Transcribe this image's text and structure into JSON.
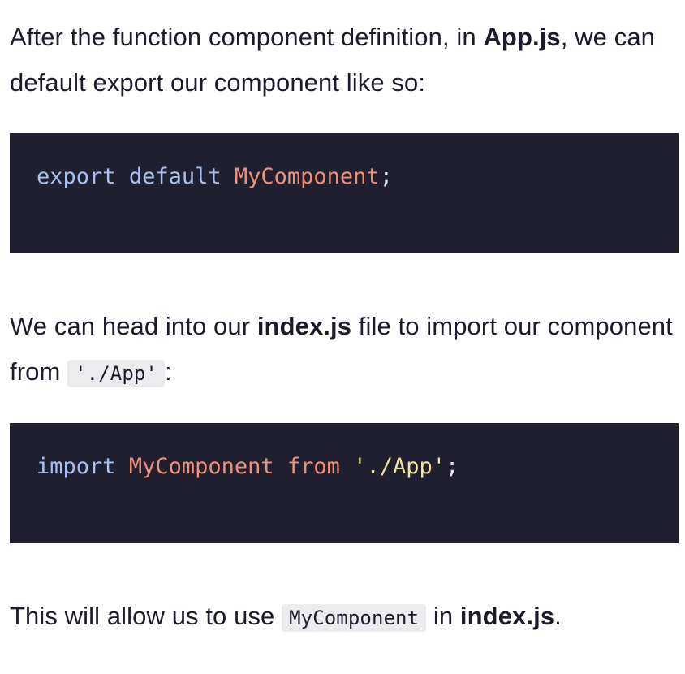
{
  "para1": {
    "text_before": "After the function component definition, in ",
    "bold_file": "App.js",
    "text_after": ", we can default export our component like so:"
  },
  "code1": {
    "kw1": "export",
    "kw2": "default",
    "identifier": "MyComponent",
    "terminator": ";"
  },
  "para2": {
    "text_before": "We can head into our ",
    "bold_file": "index.js",
    "text_middle": " file to import our component from ",
    "inline_code": "'./App'",
    "text_after": ":"
  },
  "code2": {
    "kw_import": "import",
    "identifier": "MyComponent",
    "kw_from": "from",
    "string": "'./App'",
    "terminator": ";"
  },
  "para3": {
    "text_before": "This will allow us to use ",
    "inline_code": "MyComponent",
    "text_middle": " in ",
    "bold_file": "index.js",
    "text_after": "."
  }
}
